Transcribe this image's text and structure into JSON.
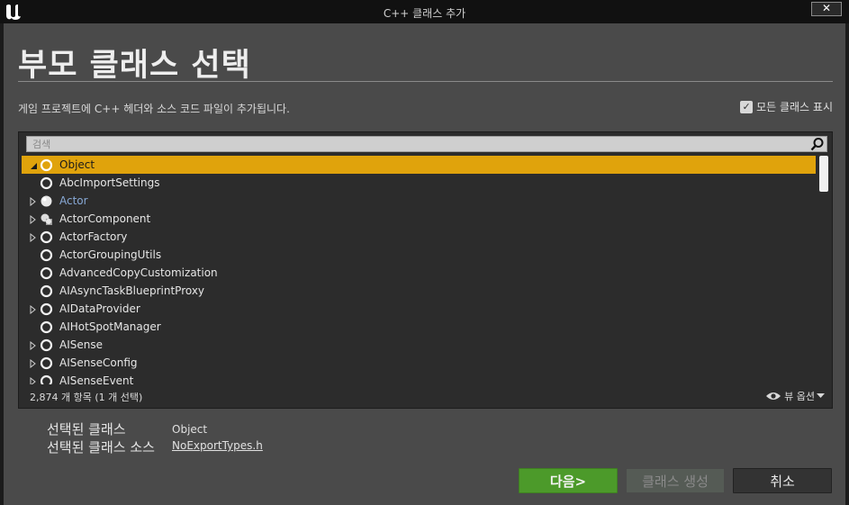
{
  "window": {
    "title": "C++ 클래스 추가",
    "close_label": "✕"
  },
  "dialog": {
    "heading": "부모 클래스 선택",
    "description": "게임 프로젝트에 C++ 헤더와 소스 코드 파일이 추가됩니다.",
    "show_all_label": "모든 클래스 표시",
    "show_all_checked": true
  },
  "search": {
    "placeholder": "검색",
    "value": ""
  },
  "tree": {
    "items": [
      {
        "label": "Object",
        "arrow": "expanded",
        "icon": "class-icon",
        "selected": true
      },
      {
        "label": "AbcImportSettings",
        "arrow": "none",
        "icon": "class-icon"
      },
      {
        "label": "Actor",
        "arrow": "collapsed",
        "icon": "actor-icon"
      },
      {
        "label": "ActorComponent",
        "arrow": "collapsed",
        "icon": "actor-component-icon"
      },
      {
        "label": "ActorFactory",
        "arrow": "collapsed",
        "icon": "class-icon"
      },
      {
        "label": "ActorGroupingUtils",
        "arrow": "none",
        "icon": "class-icon"
      },
      {
        "label": "AdvancedCopyCustomization",
        "arrow": "none",
        "icon": "class-icon"
      },
      {
        "label": "AIAsyncTaskBlueprintProxy",
        "arrow": "none",
        "icon": "class-icon"
      },
      {
        "label": "AIDataProvider",
        "arrow": "collapsed",
        "icon": "class-icon"
      },
      {
        "label": "AIHotSpotManager",
        "arrow": "none",
        "icon": "class-icon"
      },
      {
        "label": "AISense",
        "arrow": "collapsed",
        "icon": "class-icon"
      },
      {
        "label": "AISenseConfig",
        "arrow": "collapsed",
        "icon": "class-icon"
      },
      {
        "label": "AISenseEvent",
        "arrow": "collapsed",
        "icon": "class-icon"
      }
    ],
    "count_text": "2,874 개 항목 (1 개 선택)",
    "view_options_label": "뷰 옵션"
  },
  "selection": {
    "class_label": "선택된 클래스",
    "class_value": "Object",
    "source_label": "선택된 클래스 소스",
    "source_value": "NoExportTypes.h"
  },
  "buttons": {
    "next": "다음>",
    "create": "클래스 생성",
    "cancel": "취소"
  },
  "colors": {
    "selection": "#e0a30c",
    "next_button": "#4c9a2a",
    "actor_text": "#88a9d6"
  }
}
